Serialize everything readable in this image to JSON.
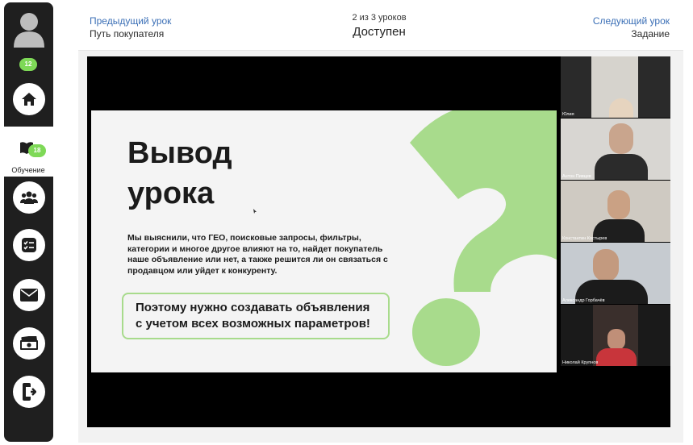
{
  "sidebar": {
    "notification_count": "12",
    "learning_count": "18",
    "learning_label": "Обучение",
    "items": [
      {
        "icon": "home-icon"
      },
      {
        "icon": "book-icon"
      },
      {
        "icon": "group-icon"
      },
      {
        "icon": "checklist-icon"
      },
      {
        "icon": "mail-icon"
      },
      {
        "icon": "money-icon"
      },
      {
        "icon": "exit-icon"
      }
    ]
  },
  "nav": {
    "prev_label": "Предыдущий урок",
    "prev_title": "Путь покупателя",
    "counter": "2 из 3 уроков",
    "status": "Доступен",
    "next_label": "Следующий урок",
    "next_title": "Задание"
  },
  "slide": {
    "title_line1": "Вывод",
    "title_line2": "урока",
    "body": "Мы выяснили, что ГЕО, поисковые запросы, фильтры, категории и многое другое влияют на то, найдет покупатель наше объявление или нет, а также решится ли он связаться с продавцом или уйдет к конкуренту.",
    "highlight_line1": "Поэтому нужно создавать объявления",
    "highlight_line2": "с учетом всех возможных параметров!"
  },
  "participants": [
    {
      "name": "Юлия"
    },
    {
      "name": "Антон Пивцев"
    },
    {
      "name": "Константин Костырев"
    },
    {
      "name": "Александр Горбачёв"
    },
    {
      "name": "Николай Крупнов"
    }
  ],
  "colors": {
    "accent_green": "#7ed957",
    "slide_green": "#a8db8c",
    "link_blue": "#3b6fb6",
    "sidebar": "#1f1f1f"
  }
}
